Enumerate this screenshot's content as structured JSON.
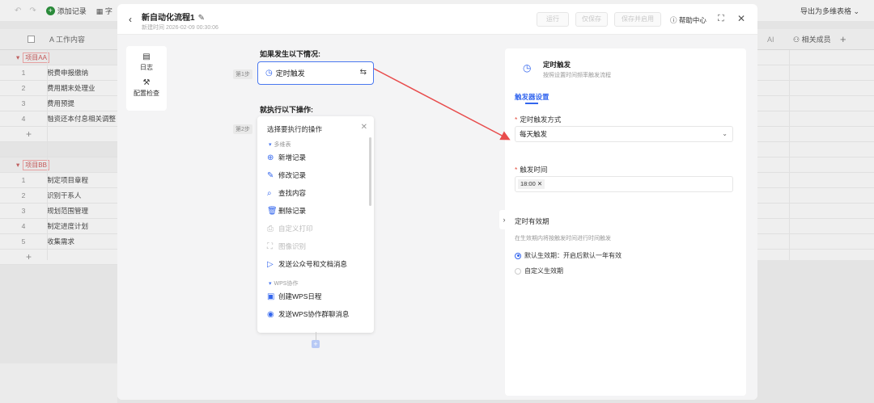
{
  "background": {
    "toolbar": {
      "add_record_label": "添加记录",
      "field_label": "字",
      "export_label": "导出为多维表格 ⌄"
    },
    "header": {
      "work_content_col": "A 工作内容",
      "ai_col": "AI",
      "members_col": "相关成员",
      "add_col": "+"
    },
    "groups": [
      {
        "name": "项目AA",
        "rows": [
          {
            "num": "1",
            "text": "税费申报缴纳"
          },
          {
            "num": "2",
            "text": "费用期末处理业"
          },
          {
            "num": "3",
            "text": "费用预提"
          },
          {
            "num": "4",
            "text": "融资还本付息相关调整"
          }
        ]
      },
      {
        "name": "项目BB",
        "rows": [
          {
            "num": "1",
            "text": "制定项目章程"
          },
          {
            "num": "2",
            "text": "识别干系人"
          },
          {
            "num": "3",
            "text": "规划范围管理"
          },
          {
            "num": "4",
            "text": "制定进度计划"
          },
          {
            "num": "5",
            "text": "收集需求"
          }
        ]
      }
    ]
  },
  "modal": {
    "title": "新自动化流程1",
    "subtitle": "新建时间 2026-02-09 00:30:06",
    "buttons": {
      "run": "运行",
      "save_only": "仅保存",
      "save_enable": "保存并启用",
      "help": "帮助中心"
    },
    "sidebar": {
      "log": "日志",
      "config_check": "配置检查"
    },
    "flow": {
      "if_label": "如果发生以下情况:",
      "step1": "第1步",
      "trigger_name": "定时触发",
      "then_label": "就执行以下操作:",
      "step2": "第2步"
    },
    "operations": {
      "header": "选择要执行的操作",
      "group1": "多维表",
      "items1": [
        {
          "label": "新增记录",
          "icon": "⊕",
          "name": "add-record",
          "disabled": false
        },
        {
          "label": "修改记录",
          "icon": "✎",
          "name": "edit-record",
          "disabled": false
        },
        {
          "label": "查找内容",
          "icon": "⌕",
          "name": "find-content",
          "disabled": false
        },
        {
          "label": "删除记录",
          "icon": "🗑",
          "name": "delete-record",
          "disabled": false
        },
        {
          "label": "自定义打印",
          "icon": "⎙",
          "name": "custom-print",
          "disabled": true
        },
        {
          "label": "图像识别",
          "icon": "⛶",
          "name": "image-recognition",
          "disabled": true
        },
        {
          "label": "发送公众号和文档消息",
          "icon": "▷",
          "name": "send-message",
          "disabled": false
        }
      ],
      "group2": "WPS协作",
      "items2": [
        {
          "label": "创建WPS日程",
          "icon": "▣",
          "name": "create-wps-schedule",
          "disabled": false
        },
        {
          "label": "发送WPS协作群聊消息",
          "icon": "◉",
          "name": "send-wps-group-message",
          "disabled": false
        }
      ]
    },
    "right_panel": {
      "title": "定时触发",
      "subtitle": "按照设置时间频率触发流程",
      "tab": "触发器设置",
      "mode_label": "定时触发方式",
      "mode_value": "每天触发",
      "time_label": "触发时间",
      "time_value": "18:00",
      "validity_label": "定时有效期",
      "validity_hint": "在生效期内将按触发时间进行时间触发",
      "option_default": "默认生效期：开启后默认一年有效",
      "option_custom": "自定义生效期"
    },
    "accent_color": "#3366ee",
    "arrow_color": "#e84c4c"
  }
}
